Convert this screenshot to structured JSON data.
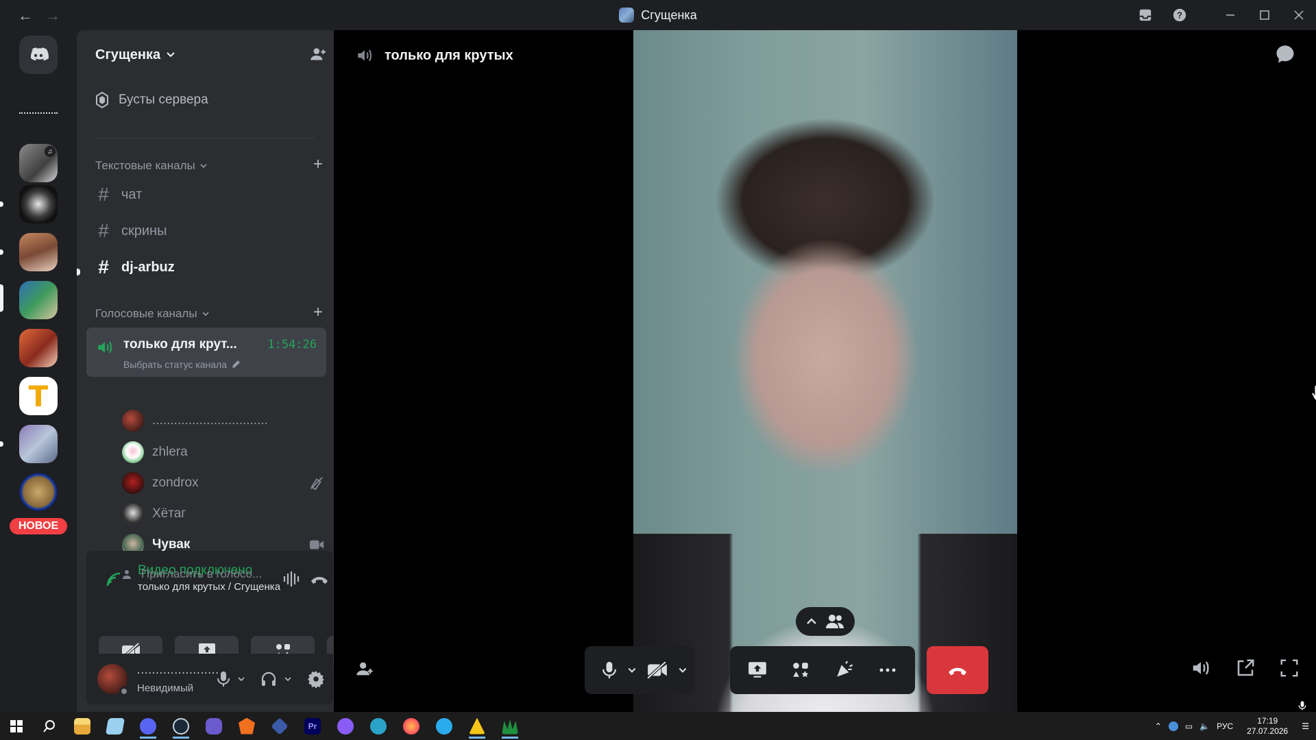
{
  "window": {
    "title": "Сгущенка"
  },
  "server": {
    "name": "Сгущенка",
    "boosts_label": "Бусты сервера"
  },
  "categories": {
    "text": "Текстовые каналы",
    "voice": "Голосовые каналы"
  },
  "text_channels": [
    {
      "name": "чат"
    },
    {
      "name": "скрины"
    },
    {
      "name": "dj-arbuz"
    }
  ],
  "voice_channel": {
    "name": "только для крут...",
    "timer": "1:54:26",
    "status_prompt": "Выбрать статус канала"
  },
  "voice_users": [
    {
      "name": "................................"
    },
    {
      "name": "zhlera"
    },
    {
      "name": "zondrox"
    },
    {
      "name": "Хётаг"
    },
    {
      "name": "Чувак"
    }
  ],
  "invite_to_voice": "Пригласить в голосо...",
  "rail": {
    "new_badge": "НОВОЕ"
  },
  "voice_panel": {
    "title": "Видео подключено",
    "subtitle": "только для крутых / Сгущенка"
  },
  "user": {
    "name": "......................",
    "status": "Невидимый"
  },
  "stage": {
    "channel_name": "только для крутых"
  },
  "taskbar": {
    "lang": "РУС",
    "time": "17:19",
    "date": "27.07.2026"
  },
  "colors": {
    "accent_green": "#23a55a",
    "danger_red": "#da373c",
    "sidebar_bg": "#2b2d31",
    "rail_bg": "#1e1f22"
  }
}
